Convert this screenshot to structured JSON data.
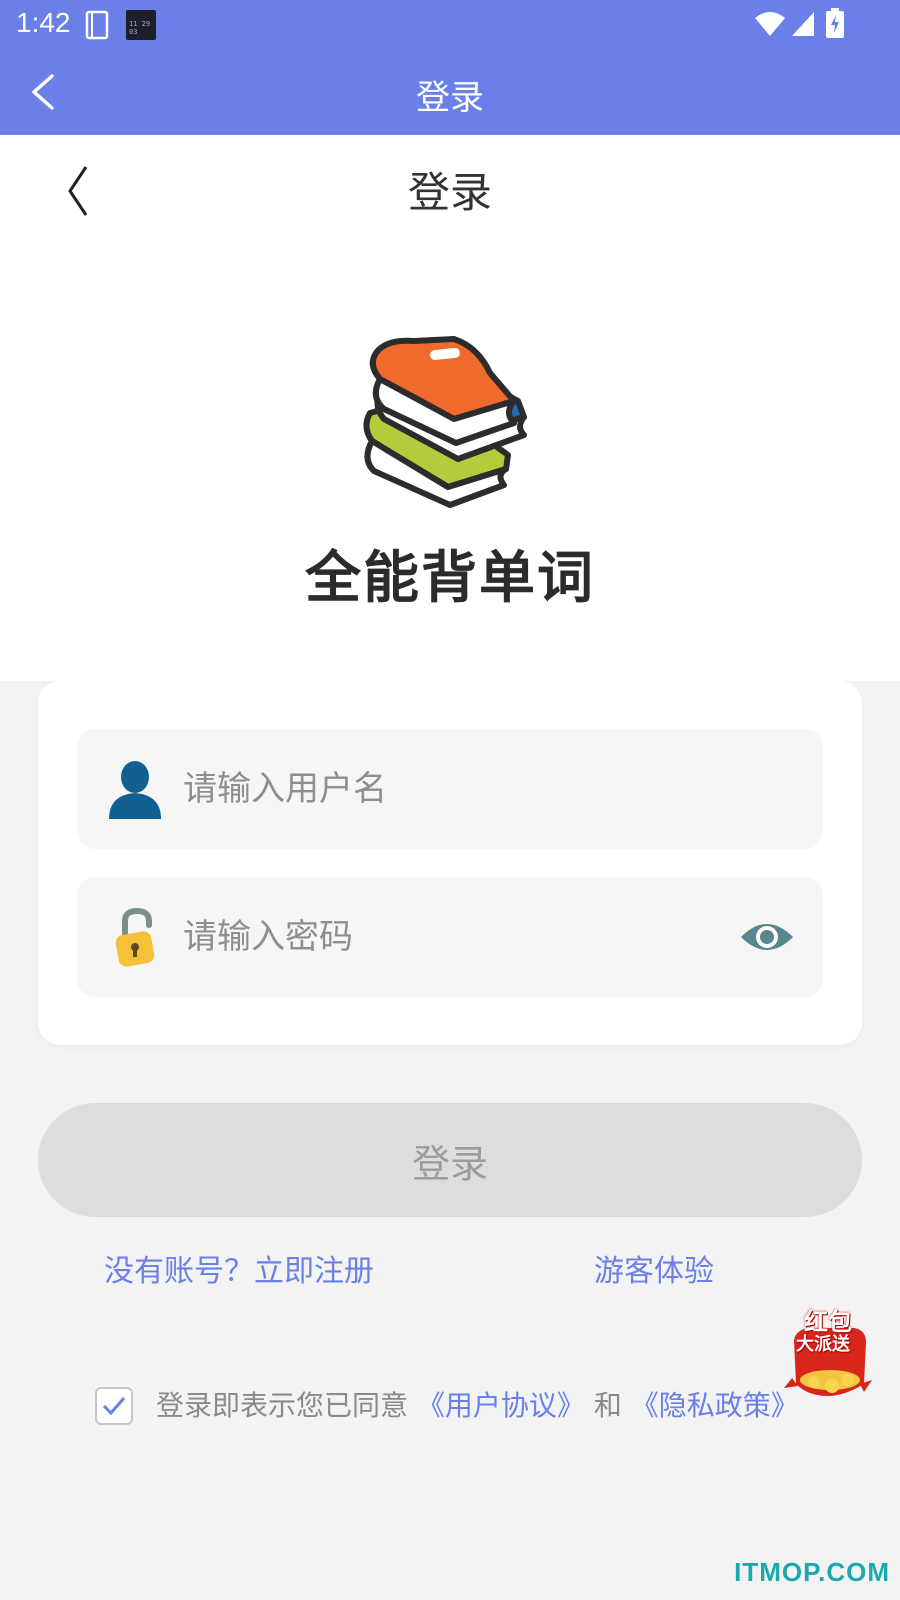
{
  "status_bar": {
    "time": "1:42",
    "clock_widget_text": "11 29 03",
    "icons": [
      "notes-icon",
      "clock-widget-icon",
      "wifi-icon",
      "signal-icon",
      "battery-charging-icon"
    ]
  },
  "app_bar": {
    "title": "登录",
    "back_icon": "chevron-left-icon",
    "color": "#6a80e8"
  },
  "page": {
    "title": "登录",
    "back_icon": "angle-bracket-left-icon"
  },
  "brand": {
    "logo_icon": "books-stack-icon",
    "app_name": "全能背单词"
  },
  "form": {
    "username": {
      "placeholder": "请输入用户名",
      "value": "",
      "icon": "user-icon"
    },
    "password": {
      "placeholder": "请输入密码",
      "value": "",
      "icon": "lock-icon",
      "toggle_icon": "eye-icon"
    },
    "login_label": "登录",
    "login_enabled": false
  },
  "links": {
    "register": "没有账号？立即注册",
    "guest": "游客体验"
  },
  "promo": {
    "line1": "红包",
    "line2": "大派送",
    "icon": "red-packet-icon"
  },
  "agreement": {
    "checked": true,
    "prefix": "登录即表示您已同意",
    "user_agreement": "《用户协议》",
    "conjunction": "和",
    "privacy_policy": "《隐私政策》"
  },
  "watermark": "ITMOP.COM",
  "colors": {
    "primary": "#6a80e8",
    "button_disabled": "#dddddd",
    "background": "#f3f3f3"
  }
}
